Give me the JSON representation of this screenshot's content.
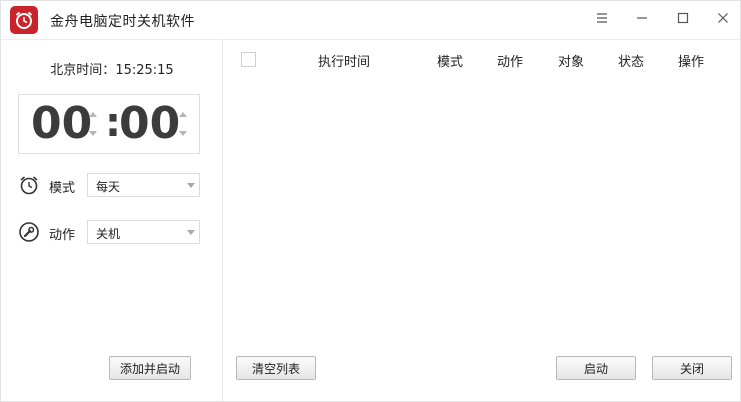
{
  "window": {
    "title": "金舟电脑定时关机软件",
    "icons": [
      "alarm-clock-app-icon",
      "menu-icon",
      "minimize-icon",
      "maximize-icon",
      "close-icon"
    ],
    "accent_color": "#c9242b"
  },
  "left": {
    "clock_prefix": "北京时间：",
    "clock_time": "15:25:15",
    "hours": "00",
    "minutes": "00",
    "colon": ":",
    "mode_label": "模式",
    "mode_value": "每天",
    "action_label": "动作",
    "action_value": "关机",
    "add_button": "添加并启动"
  },
  "table": {
    "columns": [
      "执行时间",
      "模式",
      "动作",
      "对象",
      "状态",
      "操作"
    ],
    "rows": []
  },
  "footer": {
    "clear_button": "清空列表",
    "start_button": "启动",
    "stop_button": "关闭"
  }
}
